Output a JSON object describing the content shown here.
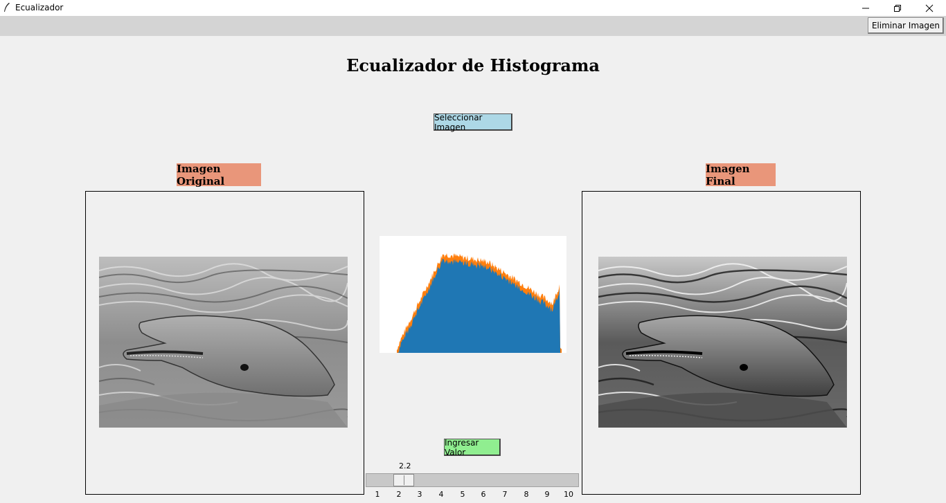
{
  "window": {
    "title": "Ecualizador"
  },
  "menubar": {
    "delete_label": "Eliminar Imagen"
  },
  "main": {
    "title": "Ecualizador de Histograma",
    "select_label": "Seleccionar Imagen",
    "original_label": "Imagen Original",
    "final_label": "Imagen Final",
    "enter_label": "Ingresar Valor"
  },
  "slider": {
    "value": "2.2",
    "min": 1,
    "max": 10,
    "ticks": [
      "1",
      "2",
      "3",
      "4",
      "5",
      "6",
      "7",
      "8",
      "9",
      "10"
    ]
  },
  "colors": {
    "title_bg": "#ffffff",
    "menubar_bg": "#d4d4d4",
    "select_button": "#add8e6",
    "enter_button": "#90ee90",
    "label_bg": "#e9967a",
    "histogram_fill": "#1f77b4",
    "histogram_edge": "#ff7f0e"
  },
  "icons": {
    "app": "feather-icon",
    "minimize": "minimize-icon",
    "restore": "restore-icon",
    "close": "close-icon"
  }
}
